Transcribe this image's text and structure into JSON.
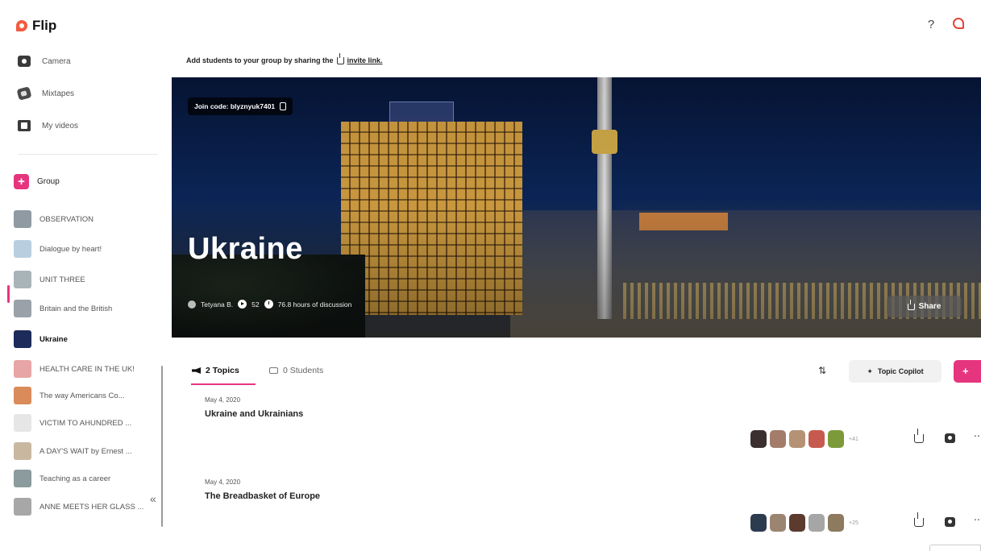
{
  "app": {
    "name": "Flip"
  },
  "header": {
    "help_symbol": "?"
  },
  "sidebar": {
    "nav": [
      {
        "label": "Camera",
        "icon": "camera-icon"
      },
      {
        "label": "Mixtapes",
        "icon": "mixtape-icon"
      },
      {
        "label": "My videos",
        "icon": "video-icon"
      }
    ],
    "group_button": {
      "plus": "+",
      "label": "Group"
    },
    "groups": [
      {
        "label": "OBSERVATION",
        "color": "#8f9aa3"
      },
      {
        "label": "Dialogue by heart!",
        "color": "#b9cfe0"
      },
      {
        "label": "UNIT THREE",
        "color": "#a9b4b8"
      },
      {
        "label": "Britain and the British",
        "color": "#9aa1a8"
      },
      {
        "label": "Ukraine",
        "color": "#1c2b5a",
        "active": true
      },
      {
        "label": "HEALTH CARE IN THE UK!",
        "color": "#e8a5a5"
      },
      {
        "label": "The way Americans Co...",
        "color": "#d98b5a"
      },
      {
        "label": "VICTIM TO AHUNDRED ...",
        "color": "#e6e6e6"
      },
      {
        "label": "A DAY'S WAIT by Ernest ...",
        "color": "#c9b8a0"
      },
      {
        "label": "Teaching as a career",
        "color": "#8b9b9e"
      },
      {
        "label": "ANNE MEETS HER GLASS ...",
        "color": "#a7a7a7"
      }
    ],
    "collapse_symbol": "«"
  },
  "invite": {
    "text": "Add students to your group by sharing the",
    "link": "invite link."
  },
  "hero": {
    "join_code": "Join code: blyznyuk7401",
    "title": "Ukraine",
    "owner": "Tetyana B.",
    "video_count": "52",
    "discussion": "76.8 hours of discussion",
    "share_label": "Share"
  },
  "tabs": {
    "topics_label": "2 Topics",
    "students_label": "0 Students"
  },
  "toolbar": {
    "sort_symbol": "⇅",
    "copilot_label": "Topic Copilot",
    "add_topic_symbol": "+"
  },
  "topics": [
    {
      "date": "May 4, 2020",
      "title": "Ukraine and Ukrainians",
      "more": "+41",
      "avatar_colors": [
        "#3b2f2f",
        "#a37c6a",
        "#b59274",
        "#c75a4e",
        "#7c9a3a"
      ]
    },
    {
      "date": "May 4, 2020",
      "title": "The Breadbasket of Europe",
      "more": "+25",
      "avatar_colors": [
        "#2d3b4f",
        "#9c8570",
        "#5c3a2e",
        "#a6a6a6",
        "#8d7a5f"
      ]
    }
  ],
  "more_symbol": "⋯",
  "accent": "#e6357f"
}
